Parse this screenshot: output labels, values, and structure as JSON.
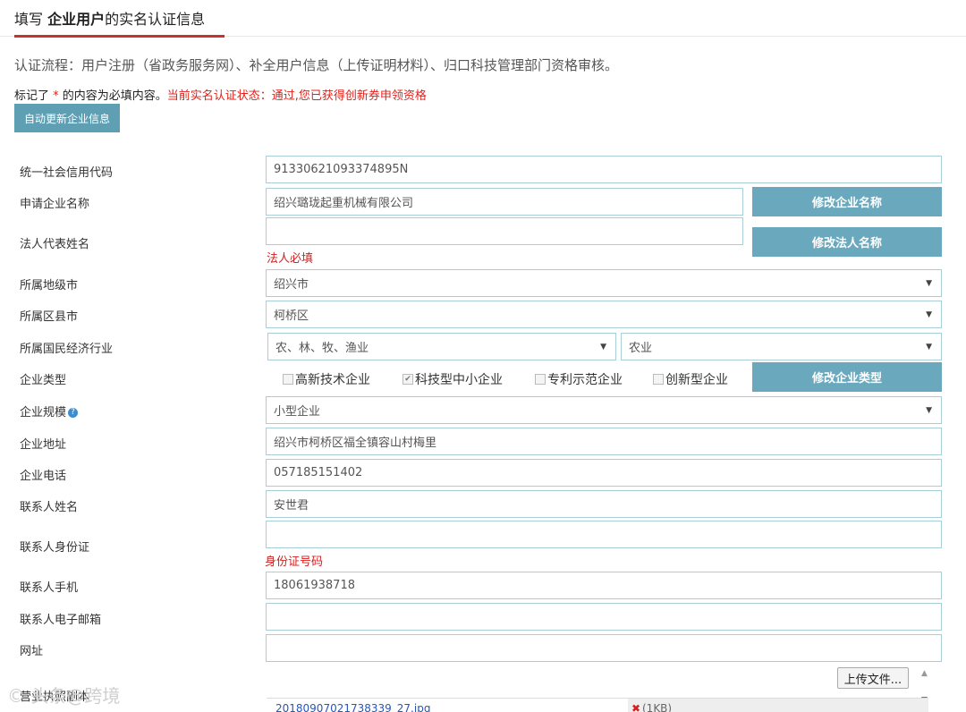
{
  "header": {
    "prefix": "填写 ",
    "bold": "企业用户",
    "suffix": "的实名认证信息"
  },
  "flow_text": "认证流程：用户注册（省政务服务网）、补全用户信息（上传证明材料）、归口科技管理部门资格审核。",
  "note": {
    "prefix": "标记了 ",
    "star": "*",
    "middle": " 的内容为必填内容。",
    "status": "当前实名认证状态：通过,您已获得创新券申领资格"
  },
  "auto_update_button": "自动更新企业信息",
  "fields": {
    "credit_code": {
      "label": "统一社会信用代码",
      "value": "91330621093374895N"
    },
    "company_name": {
      "label": "申请企业名称",
      "value": "绍兴璐珑起重机械有限公司",
      "button": "修改企业名称"
    },
    "legal_rep": {
      "label": "法人代表姓名",
      "value": "",
      "error": "法人必填",
      "button": "修改法人名称"
    },
    "city": {
      "label": "所属地级市",
      "value": "绍兴市"
    },
    "district": {
      "label": "所属区县市",
      "value": "柯桥区"
    },
    "industry": {
      "label": "所属国民经济行业",
      "value1": "农、林、牧、渔业",
      "value2": "农业"
    },
    "company_type": {
      "label": "企业类型",
      "options": [
        {
          "label": "高新技术企业",
          "checked": false
        },
        {
          "label": "科技型中小企业",
          "checked": true
        },
        {
          "label": "专利示范企业",
          "checked": false
        },
        {
          "label": "创新型企业",
          "checked": false
        }
      ],
      "button": "修改企业类型"
    },
    "scale": {
      "label": "企业规模",
      "value": "小型企业"
    },
    "address": {
      "label": "企业地址",
      "value": "绍兴市柯桥区福全镇容山村梅里"
    },
    "phone": {
      "label": "企业电话",
      "value": "057185151402"
    },
    "contact_name": {
      "label": "联系人姓名",
      "value": "安世君"
    },
    "contact_id": {
      "label": "联系人身份证",
      "value": "",
      "error": "身份证号码"
    },
    "contact_mobile": {
      "label": "联系人手机",
      "value": "18061938718"
    },
    "contact_email": {
      "label": "联系人电子邮箱",
      "value": ""
    },
    "website": {
      "label": "网址",
      "value": ""
    },
    "license": {
      "label": "营业执照副本",
      "upload_button": "上传文件...",
      "file_name": "20180907021738339_27.jpg",
      "file_size": "(1KB)"
    }
  },
  "watermark": "© 头条@跨境",
  "icons": {
    "help": "help-icon",
    "caret": "chevron-down-icon",
    "check": "checkbox-icon",
    "remove": "close-icon"
  },
  "colors": {
    "accent": "#c8332d",
    "button": "#6aa9bd",
    "error": "#d42020",
    "border": "#a8ced8"
  }
}
